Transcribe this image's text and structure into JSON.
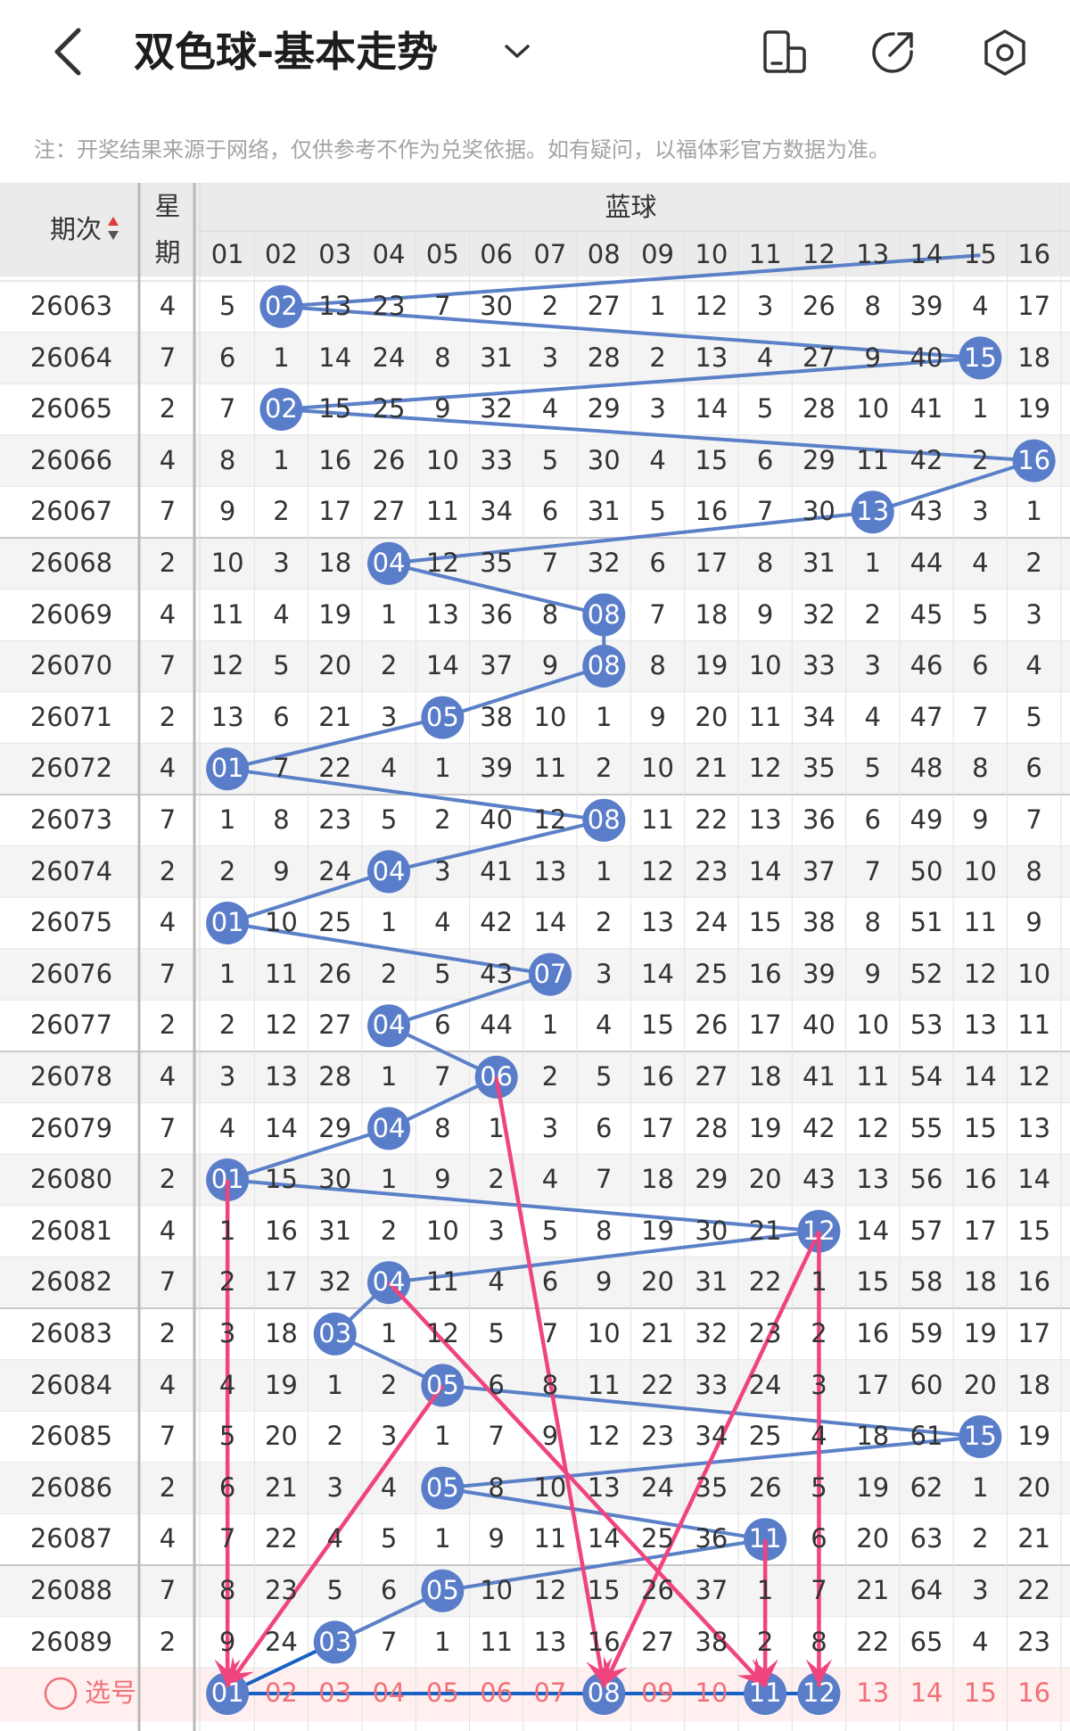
{
  "header": {
    "title": "双色球-基本走势"
  },
  "notice": "注：开奖结果来源于网络，仅供参考不作为兑奖依据。如有疑问，以福体彩官方数据为准。",
  "table": {
    "col_issue": "期次",
    "col_week": "星期",
    "col_blue": "蓝球",
    "numbers": [
      "01",
      "02",
      "03",
      "04",
      "05",
      "06",
      "07",
      "08",
      "09",
      "10",
      "11",
      "12",
      "13",
      "14",
      "15",
      "16"
    ],
    "rows": [
      {
        "issue": "26063",
        "week": "4",
        "cells": [
          "5",
          "02",
          "13",
          "23",
          "7",
          "30",
          "2",
          "27",
          "1",
          "12",
          "3",
          "26",
          "8",
          "39",
          "4",
          "17"
        ],
        "hit": 2
      },
      {
        "issue": "26064",
        "week": "7",
        "cells": [
          "6",
          "1",
          "14",
          "24",
          "8",
          "31",
          "3",
          "28",
          "2",
          "13",
          "4",
          "27",
          "9",
          "40",
          "15",
          "18"
        ],
        "hit": 15
      },
      {
        "issue": "26065",
        "week": "2",
        "cells": [
          "7",
          "02",
          "15",
          "25",
          "9",
          "32",
          "4",
          "29",
          "3",
          "14",
          "5",
          "28",
          "10",
          "41",
          "1",
          "19"
        ],
        "hit": 2
      },
      {
        "issue": "26066",
        "week": "4",
        "cells": [
          "8",
          "1",
          "16",
          "26",
          "10",
          "33",
          "5",
          "30",
          "4",
          "15",
          "6",
          "29",
          "11",
          "42",
          "2",
          "16"
        ],
        "hit": 16
      },
      {
        "issue": "26067",
        "week": "7",
        "cells": [
          "9",
          "2",
          "17",
          "27",
          "11",
          "34",
          "6",
          "31",
          "5",
          "16",
          "7",
          "30",
          "13",
          "43",
          "3",
          "1"
        ],
        "hit": 13
      },
      {
        "issue": "26068",
        "week": "2",
        "cells": [
          "10",
          "3",
          "18",
          "04",
          "12",
          "35",
          "7",
          "32",
          "6",
          "17",
          "8",
          "31",
          "1",
          "44",
          "4",
          "2"
        ],
        "hit": 4
      },
      {
        "issue": "26069",
        "week": "4",
        "cells": [
          "11",
          "4",
          "19",
          "1",
          "13",
          "36",
          "8",
          "08",
          "7",
          "18",
          "9",
          "32",
          "2",
          "45",
          "5",
          "3"
        ],
        "hit": 8
      },
      {
        "issue": "26070",
        "week": "7",
        "cells": [
          "12",
          "5",
          "20",
          "2",
          "14",
          "37",
          "9",
          "08",
          "8",
          "19",
          "10",
          "33",
          "3",
          "46",
          "6",
          "4"
        ],
        "hit": 8
      },
      {
        "issue": "26071",
        "week": "2",
        "cells": [
          "13",
          "6",
          "21",
          "3",
          "05",
          "38",
          "10",
          "1",
          "9",
          "20",
          "11",
          "34",
          "4",
          "47",
          "7",
          "5"
        ],
        "hit": 5
      },
      {
        "issue": "26072",
        "week": "4",
        "cells": [
          "01",
          "7",
          "22",
          "4",
          "1",
          "39",
          "11",
          "2",
          "10",
          "21",
          "12",
          "35",
          "5",
          "48",
          "8",
          "6"
        ],
        "hit": 1
      },
      {
        "issue": "26073",
        "week": "7",
        "cells": [
          "1",
          "8",
          "23",
          "5",
          "2",
          "40",
          "12",
          "08",
          "11",
          "22",
          "13",
          "36",
          "6",
          "49",
          "9",
          "7"
        ],
        "hit": 8
      },
      {
        "issue": "26074",
        "week": "2",
        "cells": [
          "2",
          "9",
          "24",
          "04",
          "3",
          "41",
          "13",
          "1",
          "12",
          "23",
          "14",
          "37",
          "7",
          "50",
          "10",
          "8"
        ],
        "hit": 4
      },
      {
        "issue": "26075",
        "week": "4",
        "cells": [
          "01",
          "10",
          "25",
          "1",
          "4",
          "42",
          "14",
          "2",
          "13",
          "24",
          "15",
          "38",
          "8",
          "51",
          "11",
          "9"
        ],
        "hit": 1
      },
      {
        "issue": "26076",
        "week": "7",
        "cells": [
          "1",
          "11",
          "26",
          "2",
          "5",
          "43",
          "07",
          "3",
          "14",
          "25",
          "16",
          "39",
          "9",
          "52",
          "12",
          "10"
        ],
        "hit": 7
      },
      {
        "issue": "26077",
        "week": "2",
        "cells": [
          "2",
          "12",
          "27",
          "04",
          "6",
          "44",
          "1",
          "4",
          "15",
          "26",
          "17",
          "40",
          "10",
          "53",
          "13",
          "11"
        ],
        "hit": 4
      },
      {
        "issue": "26078",
        "week": "4",
        "cells": [
          "3",
          "13",
          "28",
          "1",
          "7",
          "06",
          "2",
          "5",
          "16",
          "27",
          "18",
          "41",
          "11",
          "54",
          "14",
          "12"
        ],
        "hit": 6
      },
      {
        "issue": "26079",
        "week": "7",
        "cells": [
          "4",
          "14",
          "29",
          "04",
          "8",
          "1",
          "3",
          "6",
          "17",
          "28",
          "19",
          "42",
          "12",
          "55",
          "15",
          "13"
        ],
        "hit": 4
      },
      {
        "issue": "26080",
        "week": "2",
        "cells": [
          "01",
          "15",
          "30",
          "1",
          "9",
          "2",
          "4",
          "7",
          "18",
          "29",
          "20",
          "43",
          "13",
          "56",
          "16",
          "14"
        ],
        "hit": 1
      },
      {
        "issue": "26081",
        "week": "4",
        "cells": [
          "1",
          "16",
          "31",
          "2",
          "10",
          "3",
          "5",
          "8",
          "19",
          "30",
          "21",
          "12",
          "14",
          "57",
          "17",
          "15"
        ],
        "hit": 12
      },
      {
        "issue": "26082",
        "week": "7",
        "cells": [
          "2",
          "17",
          "32",
          "04",
          "11",
          "4",
          "6",
          "9",
          "20",
          "31",
          "22",
          "1",
          "15",
          "58",
          "18",
          "16"
        ],
        "hit": 4
      },
      {
        "issue": "26083",
        "week": "2",
        "cells": [
          "3",
          "18",
          "03",
          "1",
          "12",
          "5",
          "7",
          "10",
          "21",
          "32",
          "23",
          "2",
          "16",
          "59",
          "19",
          "17"
        ],
        "hit": 3
      },
      {
        "issue": "26084",
        "week": "4",
        "cells": [
          "4",
          "19",
          "1",
          "2",
          "05",
          "6",
          "8",
          "11",
          "22",
          "33",
          "24",
          "3",
          "17",
          "60",
          "20",
          "18"
        ],
        "hit": 5
      },
      {
        "issue": "26085",
        "week": "7",
        "cells": [
          "5",
          "20",
          "2",
          "3",
          "1",
          "7",
          "9",
          "12",
          "23",
          "34",
          "25",
          "4",
          "18",
          "61",
          "15",
          "19"
        ],
        "hit": 15
      },
      {
        "issue": "26086",
        "week": "2",
        "cells": [
          "6",
          "21",
          "3",
          "4",
          "05",
          "8",
          "10",
          "13",
          "24",
          "35",
          "26",
          "5",
          "19",
          "62",
          "1",
          "20"
        ],
        "hit": 5
      },
      {
        "issue": "26087",
        "week": "4",
        "cells": [
          "7",
          "22",
          "4",
          "5",
          "1",
          "9",
          "11",
          "14",
          "25",
          "36",
          "11",
          "6",
          "20",
          "63",
          "2",
          "21"
        ],
        "hit": 11
      },
      {
        "issue": "26088",
        "week": "7",
        "cells": [
          "8",
          "23",
          "5",
          "6",
          "05",
          "10",
          "12",
          "15",
          "26",
          "37",
          "1",
          "7",
          "21",
          "64",
          "3",
          "22"
        ],
        "hit": 5
      },
      {
        "issue": "26089",
        "week": "2",
        "cells": [
          "9",
          "24",
          "03",
          "7",
          "1",
          "11",
          "13",
          "16",
          "27",
          "38",
          "2",
          "8",
          "22",
          "65",
          "4",
          "23"
        ],
        "hit": 3
      }
    ],
    "selection_label": "选号",
    "selected": [
      1,
      8,
      11,
      12
    ],
    "arrows": [
      [
        26080,
        1,
        1
      ],
      [
        26078,
        6,
        8
      ],
      [
        26082,
        4,
        11
      ],
      [
        26081,
        12,
        8
      ],
      [
        26084,
        5,
        1
      ],
      [
        26087,
        11,
        11
      ],
      [
        26081,
        12,
        12
      ]
    ]
  },
  "colors": {
    "ball": "#5a7dc9",
    "line": "#5b80c8",
    "final_line": "#1760c4",
    "arrow": "#f0447e",
    "header_bg": "#ebebeb",
    "even_row": "#f4f4f4",
    "select_bg": "#fff0ef",
    "select_text": "#f16f78"
  }
}
